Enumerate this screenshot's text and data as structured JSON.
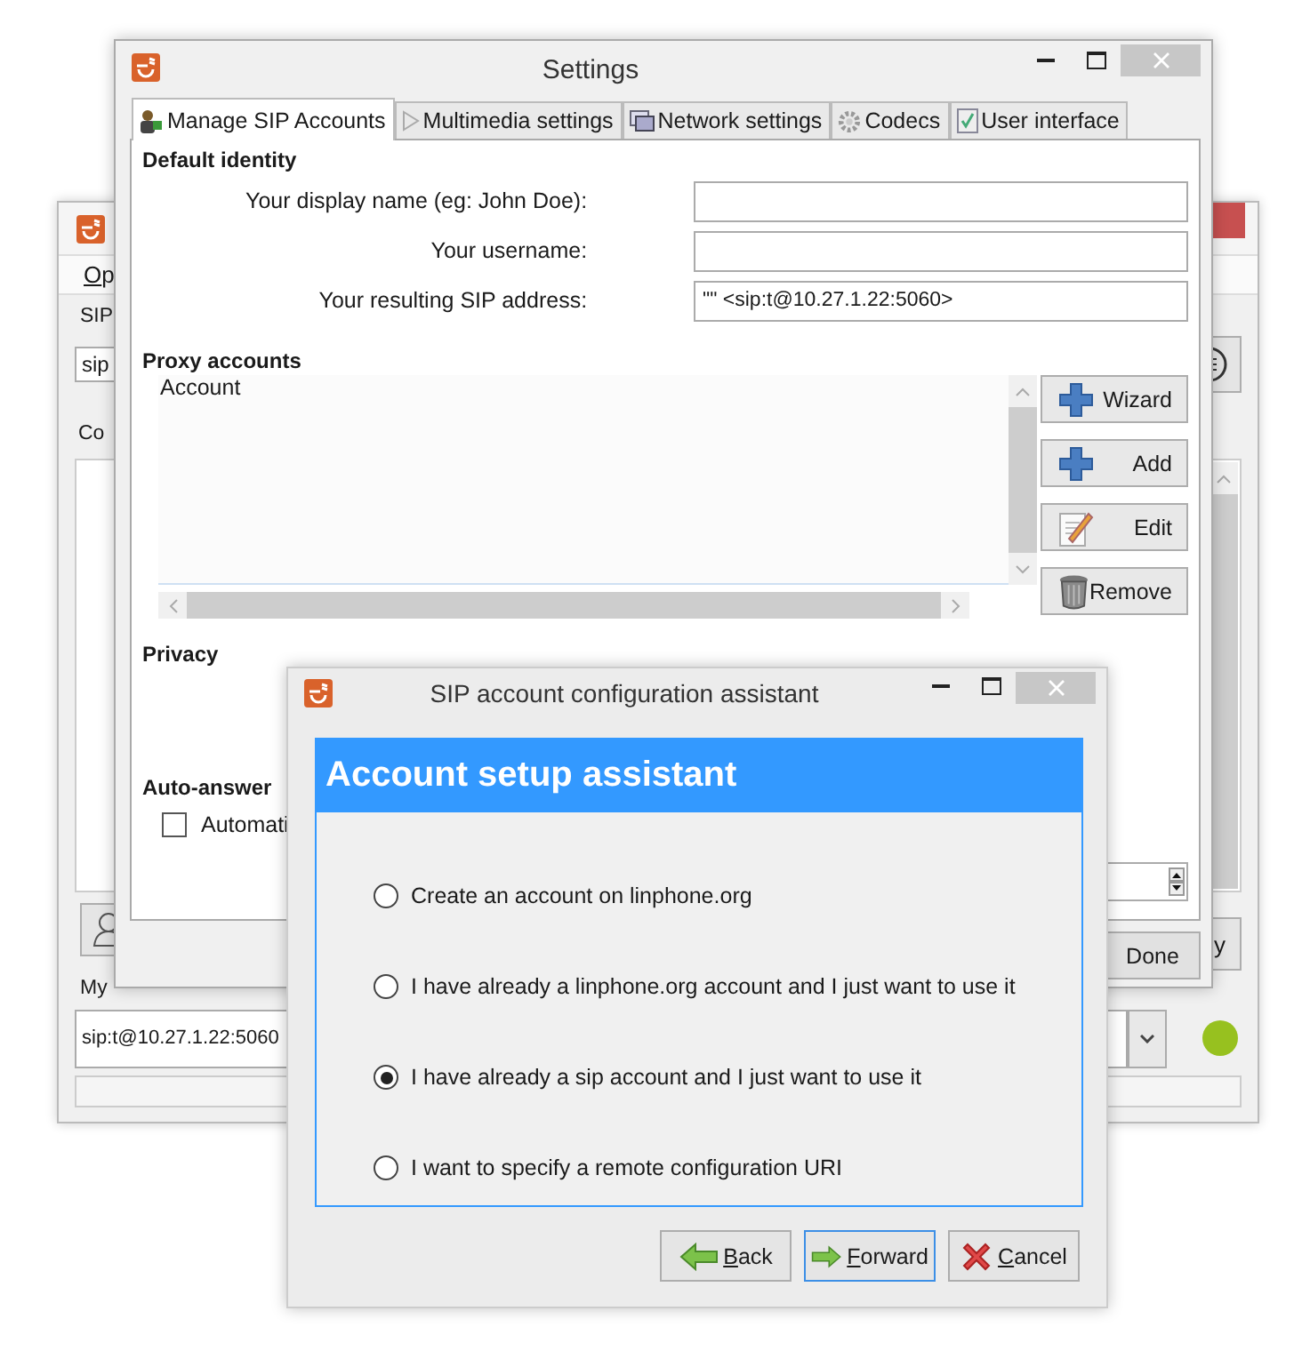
{
  "main_window": {
    "menu": [
      "Op"
    ],
    "sip_label": "SIP",
    "sip_field": "sip",
    "contacts_label": "Co",
    "action_button": "y",
    "my_label": "My",
    "identity_value": "sip:t@10.27.1.22:5060"
  },
  "settings": {
    "title": "Settings",
    "tabs": [
      {
        "label": "Manage SIP Accounts",
        "selected": true
      },
      {
        "label": "Multimedia settings",
        "selected": false
      },
      {
        "label": "Network settings",
        "selected": false
      },
      {
        "label": "Codecs",
        "selected": false
      },
      {
        "label": "User interface",
        "selected": false
      }
    ],
    "default_identity": {
      "heading": "Default identity",
      "fields": [
        {
          "label": "Your display name (eg: John Doe):"
        },
        {
          "label": "Your username:"
        },
        {
          "label": "Your resulting SIP address:",
          "value": "\"\" <sip:t@10.27.1.22:5060>"
        }
      ]
    },
    "proxy_accounts": {
      "heading": "Proxy accounts",
      "columns": [
        "Account"
      ],
      "buttons": [
        "Wizard",
        "Add",
        "Edit",
        "Remove"
      ]
    },
    "privacy": {
      "heading": "Privacy"
    },
    "auto_answer": {
      "heading": "Auto-answer",
      "checkbox": {
        "label": "Automati",
        "checked": false
      }
    },
    "done_button": "Done"
  },
  "assistant": {
    "title": "SIP account configuration assistant",
    "header": "Account setup assistant",
    "options": [
      {
        "label": "Create an account on linphone.org",
        "selected": false
      },
      {
        "label": "I have already a linphone.org account and I just want to use it",
        "selected": false
      },
      {
        "label": "I have already a sip account and I just want to use it",
        "selected": true
      },
      {
        "label": "I want to specify a remote configuration URI",
        "selected": false
      }
    ],
    "buttons": [
      {
        "label": "Back",
        "focused": false
      },
      {
        "label": "Forward",
        "focused": true
      },
      {
        "label": "Cancel",
        "focused": false
      }
    ]
  }
}
